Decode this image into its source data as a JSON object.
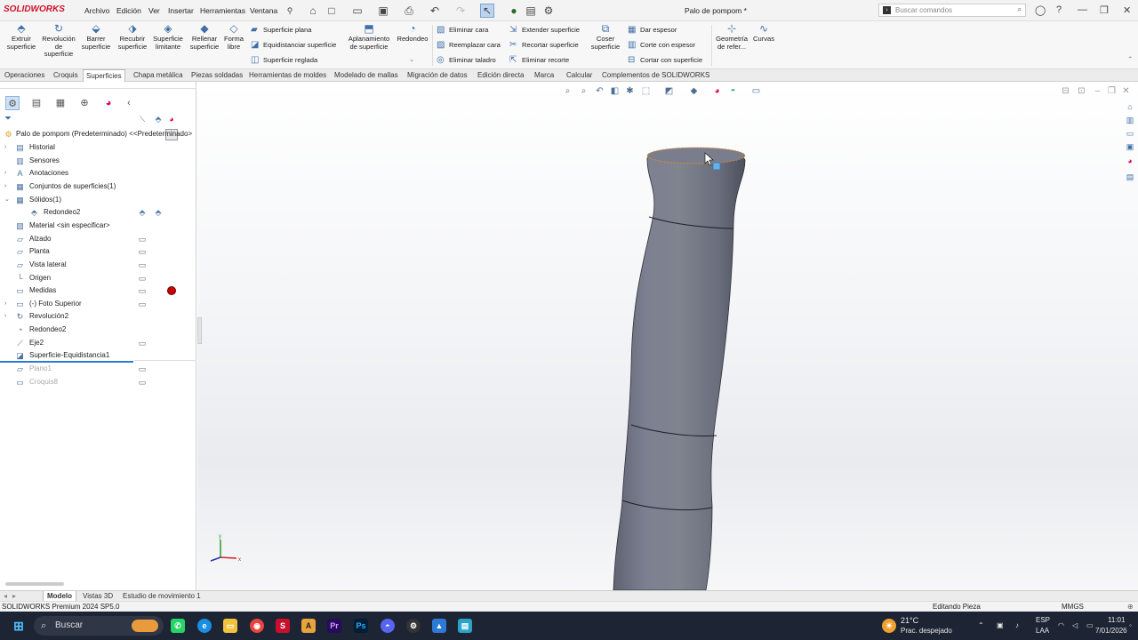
{
  "app": {
    "logo": "SOLIDWORKS",
    "doc_title": "Palo de pompom *"
  },
  "menu": [
    "Archivo",
    "Edición",
    "Ver",
    "Insertar",
    "Herramientas",
    "Ventana"
  ],
  "search": {
    "placeholder": "Buscar comandos"
  },
  "ribbon": {
    "big": [
      {
        "label": "Extruir superficie",
        "icon": "extrude-surface-icon"
      },
      {
        "label": "Revolución de superficie",
        "icon": "revolve-surface-icon"
      },
      {
        "label": "Barrer superficie",
        "icon": "sweep-surface-icon"
      },
      {
        "label": "Recubrir superficie",
        "icon": "loft-surface-icon"
      },
      {
        "label": "Superficie limitante",
        "icon": "boundary-surface-icon"
      },
      {
        "label": "Rellenar superficie",
        "icon": "fill-surface-icon"
      },
      {
        "label": "Forma libre",
        "icon": "freeform-icon"
      }
    ],
    "col1": [
      "Superficie plana",
      "Equidistanciar superficie",
      "Superficie reglada"
    ],
    "aplanamiento": "Aplanamiento de superficie",
    "redondeo": "Redondeo",
    "col2": [
      "Eliminar cara",
      "Reemplazar cara",
      "Eliminar taladro"
    ],
    "col3": [
      "Extender superficie",
      "Recortar superficie",
      "Eliminar recorte"
    ],
    "coser": "Coser superficie",
    "col4": [
      "Dar espesor",
      "Corte con espesor",
      "Cortar con superficie"
    ],
    "geometria": "Geometría de refer...",
    "curvas": "Curvas"
  },
  "tabs": [
    "Operaciones",
    "Croquis",
    "Superficies",
    "Chapa metálica",
    "Piezas soldadas",
    "Herramientas de moldes",
    "Modelado de mallas",
    "Migración de datos",
    "Edición directa",
    "Marca",
    "Calcular",
    "Complementos de SOLIDWORKS"
  ],
  "active_tab": "Superficies",
  "tree": {
    "root": "Palo de pompom (Predeterminado) <<Predeterminado>",
    "items": [
      {
        "label": "Historial",
        "icon": "history-icon",
        "expand": "›"
      },
      {
        "label": "Sensores",
        "icon": "sensor-icon",
        "expand": ""
      },
      {
        "label": "Anotaciones",
        "icon": "annotations-icon",
        "expand": "›"
      },
      {
        "label": "Conjuntos de superficies(1)",
        "icon": "surface-bodies-icon",
        "expand": "›"
      },
      {
        "label": "Sólidos(1)",
        "icon": "solid-bodies-icon",
        "expand": "⌄"
      },
      {
        "label": "Redondeo2",
        "icon": "fillet-body-icon",
        "expand": ""
      },
      {
        "label": "Material <sin especificar>",
        "icon": "material-icon",
        "expand": ""
      },
      {
        "label": "Alzado",
        "icon": "plane-icon",
        "expand": ""
      },
      {
        "label": "Planta",
        "icon": "plane-icon",
        "expand": ""
      },
      {
        "label": "Vista lateral",
        "icon": "plane-icon",
        "expand": ""
      },
      {
        "label": "Origen",
        "icon": "origin-icon",
        "expand": ""
      },
      {
        "label": "Medidas",
        "icon": "folder-icon",
        "expand": ""
      },
      {
        "label": "(-) Foto Superior",
        "icon": "sketch-icon",
        "expand": "›"
      },
      {
        "label": "Revolución2",
        "icon": "revolve-icon",
        "expand": "›"
      },
      {
        "label": "Redondeo2",
        "icon": "fillet-icon",
        "expand": ""
      },
      {
        "label": "Eje2",
        "icon": "axis-icon",
        "expand": ""
      },
      {
        "label": "Superficie-Equidistancia1",
        "icon": "offset-surface-icon",
        "expand": ""
      },
      {
        "label": "Plano1",
        "icon": "plane-icon",
        "expand": ""
      },
      {
        "label": "Croquis8",
        "icon": "sketch-icon",
        "expand": ""
      }
    ]
  },
  "bottom_tabs": [
    "Modelo",
    "Vistas 3D",
    "Estudio de movimiento 1"
  ],
  "status": {
    "left": "SOLIDWORKS Premium 2024 SP5.0",
    "mid": "Editando Pieza",
    "units": "MMGS"
  },
  "taskbar": {
    "search": "Buscar",
    "weather_temp": "21°C",
    "weather_desc": "Prac. despejado",
    "lang": "ESP",
    "lang2": "LAA",
    "time": "11:01",
    "date": "7/01/2026"
  }
}
